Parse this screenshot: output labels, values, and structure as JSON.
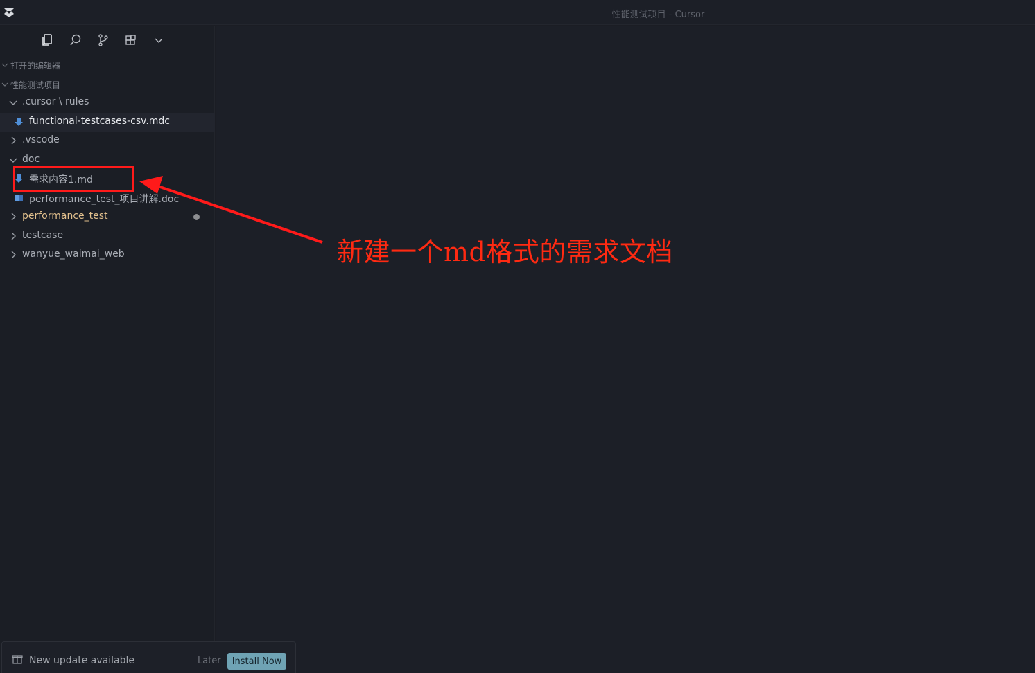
{
  "window": {
    "title": "性能测试项目 - Cursor"
  },
  "activity_bar": {
    "icons": [
      "explorer-icon",
      "search-icon",
      "source-control-icon",
      "extensions-icon",
      "chevron-down-icon"
    ]
  },
  "sections": {
    "open_editors": "打开的编辑器",
    "project": "性能测试项目"
  },
  "tree": {
    "cursor_rules": ".cursor \\ rules",
    "mdc_file": "functional-testcases-csv.mdc",
    "vscode": ".vscode",
    "doc": "doc",
    "md_file": "需求内容1.md",
    "doc_file": "performance_test_项目讲解.doc",
    "perf_test": "performance_test",
    "testcase": "testcase",
    "waimai": "wanyue_waimai_web"
  },
  "annotation": {
    "text": "新建一个md格式的需求文档",
    "color": "#ff2a12"
  },
  "toast": {
    "message": "New update available",
    "later": "Later",
    "install": "Install Now"
  },
  "colors": {
    "background": "#1b1d24",
    "accent_button": "#6fa3b4",
    "modified": "#e2c08d",
    "markdown_icon": "#4f8fd8"
  }
}
